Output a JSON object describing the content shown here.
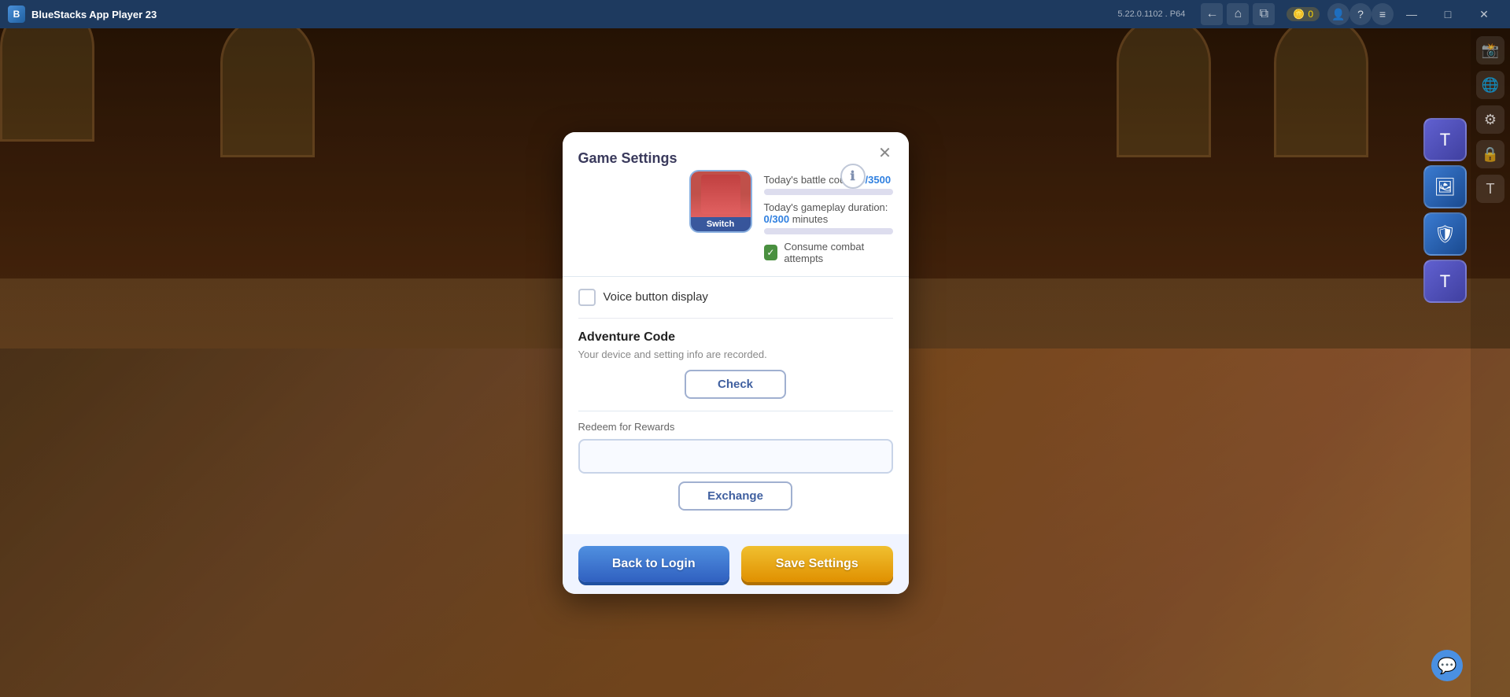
{
  "app": {
    "title": "BlueStacks App Player 23",
    "version": "5.22.0.1102 . P64",
    "coin_count": "0"
  },
  "titlebar": {
    "back_label": "←",
    "home_label": "⌂",
    "copy_label": "⧉",
    "minimize_label": "—",
    "maximize_label": "□",
    "close_label": "✕",
    "help_label": "?",
    "menu_label": "≡",
    "profile_label": "👤"
  },
  "sidebar": {
    "icons": [
      "📸",
      "🌐",
      "⚙",
      "🔒",
      "T"
    ]
  },
  "ingame_panels": {
    "items": [
      {
        "icon": "T",
        "label": "chat-top"
      },
      {
        "icon": "🖼",
        "label": "screenshot"
      },
      {
        "icon": "🛡",
        "label": "shield"
      },
      {
        "icon": "T",
        "label": "chat-bottom"
      }
    ]
  },
  "dialog": {
    "title": "Game Settings",
    "close_label": "✕",
    "character": {
      "label": "Switch"
    },
    "battle_count_label": "Today's battle count:",
    "battle_count_value": "0/3500",
    "gameplay_duration_label": "Today's gameplay duration:",
    "gameplay_duration_value": "0/300",
    "gameplay_duration_unit": "minutes",
    "consume_label": "Consume combat attempts",
    "info_icon": "ℹ",
    "voice_section": {
      "label": "Voice button display",
      "checked": false
    },
    "adventure_code": {
      "title": "Adventure Code",
      "description": "Your device and setting info are recorded.",
      "check_button_label": "Check"
    },
    "redeem": {
      "label": "Redeem for Rewards",
      "placeholder": "",
      "exchange_button_label": "Exchange"
    },
    "back_to_login_label": "Back to Login",
    "save_settings_label": "Save Settings"
  },
  "float_btn": {
    "icon": "💬"
  }
}
